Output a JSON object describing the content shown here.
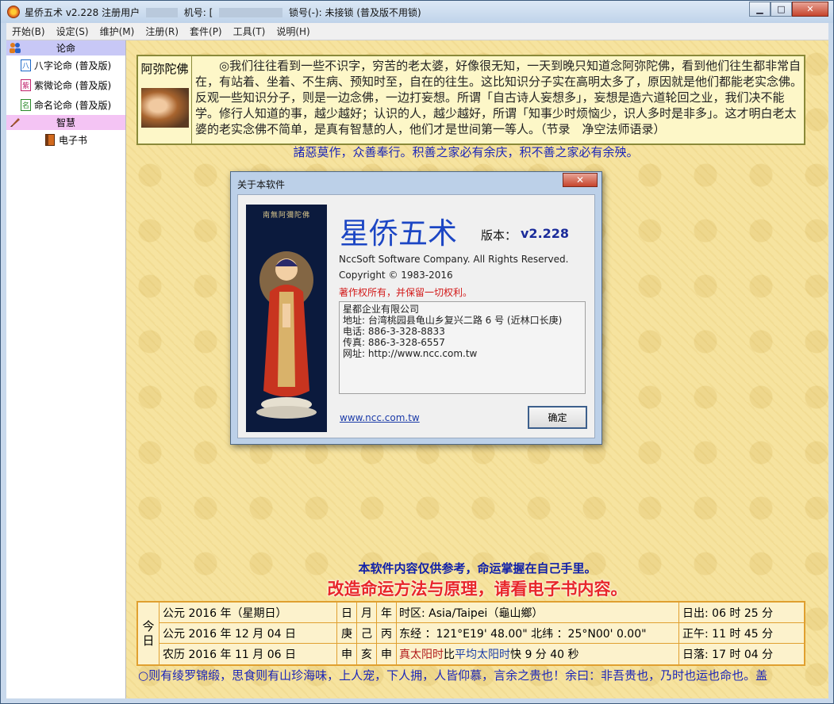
{
  "window": {
    "title_app": "星侨五术 v2.228",
    "title_user_label": "注册用户",
    "title_machine_label": "机号: [",
    "title_lock": "锁号(-): 未接锁 (普及版不用锁)",
    "buttons": {
      "minimize": "▁",
      "maximize": "□",
      "close": "✕"
    }
  },
  "menu": [
    "开始(B)",
    "设定(S)",
    "维护(M)",
    "注册(R)",
    "套件(P)",
    "工具(T)",
    "说明(H)"
  ],
  "sidebar": {
    "section_lunming": "论命",
    "items": [
      {
        "label": "八字论命 (普及版)",
        "icon": "八"
      },
      {
        "label": "紫微论命 (普及版)",
        "icon": "紫"
      },
      {
        "label": "命名论命 (普及版)",
        "icon": "名"
      }
    ],
    "section_wisdom": "智慧",
    "ebook": "电子书"
  },
  "quote": {
    "name": "阿弥陀佛",
    "text": "◎我们往往看到一些不识字，穷苦的老太婆，好像很无知，一天到晚只知道念阿弥陀佛，看到他们往生都非常自在，有站着、坐着、不生病、预知时至，自在的往生。这比知识分子实在高明太多了，原因就是他们都能老实念佛。反观一些知识分子，则是一边念佛，一边打妄想。所谓「自古诗人妄想多」，妄想是造六道轮回之业，我们决不能学。修行人知道的事，越少越好；认识的人，越少越好，所谓「知事少时烦恼少，识人多时是非多」。这才明白老太婆的老实念佛不简单，是真有智慧的人，他们才是世间第一等人。（节录　净空法师语录）"
  },
  "motto": "諸惡莫作，众善奉行。积善之家必有余庆，积不善之家必有余殃。",
  "dialog": {
    "title": "关于本软件",
    "close": "✕",
    "buddha_caption": "南無阿彌陀佛",
    "app_name": "星侨五术",
    "version_label": "版本：",
    "version": "v2.228",
    "company": "NccSoft Software Company. All Rights Reserved.",
    "copyright": "Copyright © 1983-2016",
    "rights": "著作权所有，并保留一切权利。",
    "info_lines": [
      "星都企业有限公司",
      "地址: 台湾桃园县龟山乡复兴二路 6 号 (近林口长庚)",
      "电话: 886-3-328-8833",
      "传真: 886-3-328-6557",
      "网址: http://www.ncc.com.tw"
    ],
    "link": "www.ncc.com.tw",
    "ok": "确定"
  },
  "notice": {
    "line1": "本软件内容仅供参考，命运掌握在自己手里。",
    "line2": "改造命运方法与原理，请看电子书内容。"
  },
  "date_table": {
    "today": [
      "今",
      "日"
    ],
    "rows": [
      {
        "date": "公元  2016 年（星期日）",
        "gz": [
          "日",
          "月",
          "年"
        ],
        "info": "时区: Asia/Taipei（龜山鄉）",
        "sun": "日出: 06 时  25 分"
      },
      {
        "date": "公元  2016 年  12 月  04 日",
        "gz": [
          "庚",
          "己",
          "丙"
        ],
        "info": "东经 ：121°E19' 48.00\" 北纬 ：25°N00' 0.00\"",
        "sun": "正午: 11 时  45 分"
      },
      {
        "date": "农历  2016 年  11 月  06 日",
        "gz": [
          "申",
          "亥",
          "申"
        ],
        "info_red": "真太阳时",
        "info_mid": "比",
        "info_blue": "平均太阳时",
        "info_tail": "快  9 分  40 秒",
        "sun": "日落: 17 时  04 分"
      }
    ]
  },
  "scroll_text": "○则有绫罗锦缎，思食则有山珍海味，上人宠，下人拥，人皆仰慕，言余之贵也！余曰：非吾贵也，乃时也运也命也。盖"
}
